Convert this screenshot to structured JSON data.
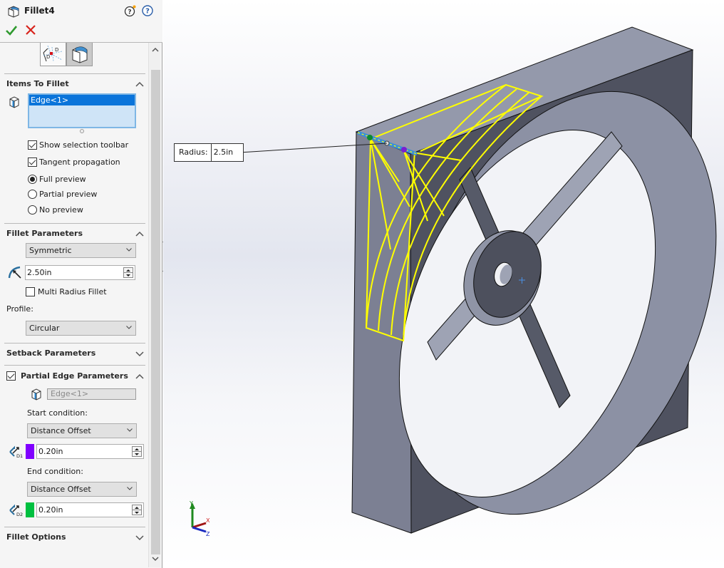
{
  "header": {
    "title": "Fillet4",
    "whats_new_icon": "help-whats-new-icon",
    "help_icon": "help-icon",
    "ok_icon": "checkmark-icon",
    "cancel_icon": "close-icon"
  },
  "tabs": [
    {
      "name": "manual-tab",
      "icon": "fillet-xpert-icon",
      "active": false
    },
    {
      "name": "fillet-tab",
      "icon": "fillet-icon",
      "active": true
    }
  ],
  "items_to_fillet": {
    "title": "Items To Fillet",
    "selection": [
      "Edge<1>"
    ],
    "show_selection_toolbar": {
      "label": "Show selection toolbar",
      "checked": true
    },
    "tangent_propagation": {
      "label": "Tangent propagation",
      "checked": true
    },
    "preview_options": [
      {
        "label": "Full preview",
        "selected": true
      },
      {
        "label": "Partial preview",
        "selected": false
      },
      {
        "label": "No preview",
        "selected": false
      }
    ]
  },
  "fillet_parameters": {
    "title": "Fillet Parameters",
    "method": "Symmetric",
    "radius": "2.50in",
    "multi_radius": {
      "label": "Multi Radius Fillet",
      "checked": false
    },
    "profile_label": "Profile:",
    "profile": "Circular"
  },
  "setback_parameters": {
    "title": "Setback Parameters",
    "expanded": false
  },
  "partial_edge_parameters": {
    "title": "Partial Edge Parameters",
    "enabled": true,
    "edge": "Edge<1>",
    "start_condition_label": "Start condition:",
    "start_condition": "Distance Offset",
    "start_offset": "0.20in",
    "start_color": "#8000ff",
    "start_icon_label": "D1",
    "end_condition_label": "End condition:",
    "end_condition": "Distance Offset",
    "end_offset": "0.20in",
    "end_color": "#00c040",
    "end_icon_label": "D2"
  },
  "fillet_options": {
    "title": "Fillet Options",
    "expanded": false
  },
  "viewport": {
    "callout_label": "Radius:",
    "callout_value": "2.5in",
    "triad": {
      "x": "X",
      "y": "Y",
      "z": "Z"
    },
    "preview_color": "#ffff00",
    "selected_edge_color": "#3a8fd8"
  }
}
